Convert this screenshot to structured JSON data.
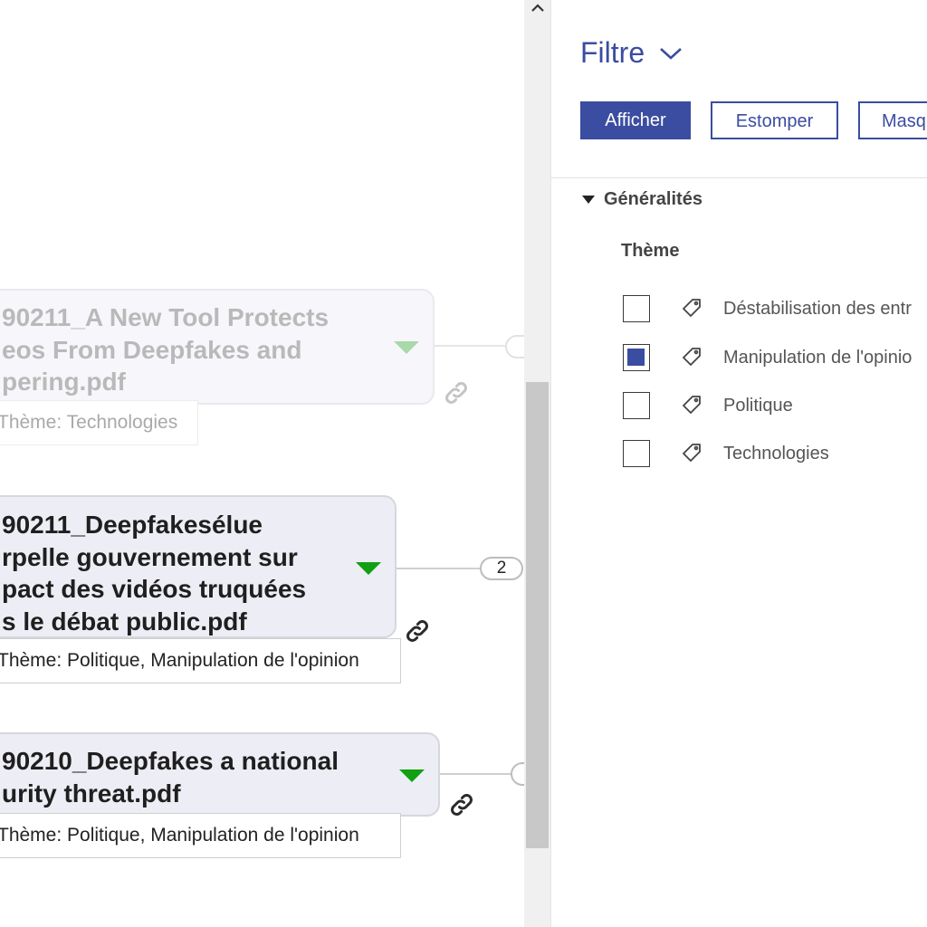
{
  "nodes": [
    {
      "lines": [
        "90211_A New Tool Protects",
        "eos From Deepfakes and",
        "pering.pdf"
      ],
      "theme": "Thème: Technologies",
      "faded": true
    },
    {
      "lines": [
        "90211_Deepfakesélue",
        "rpelle gouvernement sur",
        "pact des vidéos truquées",
        "s le débat public.pdf"
      ],
      "theme": "Thème: Politique, Manipulation de l'opinion",
      "child_count": "2",
      "faded": false
    },
    {
      "lines": [
        "90210_Deepfakes a national",
        "urity threat.pdf"
      ],
      "theme": "Thème: Politique, Manipulation de l'opinion",
      "faded": false
    }
  ],
  "panel": {
    "title": "Filtre",
    "buttons": {
      "show": "Afficher",
      "fade": "Estomper",
      "hide": "Masq"
    },
    "section": "Généralités",
    "subsection": "Thème",
    "filters": [
      {
        "label": "Déstabilisation des entr",
        "checked": false
      },
      {
        "label": "Manipulation de l'opinio",
        "checked": true
      },
      {
        "label": "Politique",
        "checked": false
      },
      {
        "label": "Technologies",
        "checked": false
      }
    ]
  },
  "colors": {
    "accent": "#3b4da0",
    "node_arrow": "#11a011",
    "node_bg": "#ededf5"
  },
  "icons": [
    "link-icon",
    "tag-icon",
    "chevron-down-icon",
    "chevron-up-icon",
    "caret-down-icon"
  ]
}
